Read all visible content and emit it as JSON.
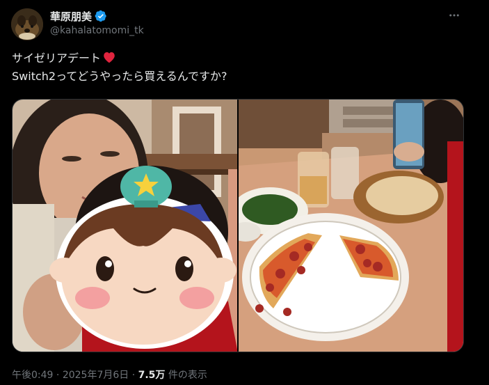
{
  "author": {
    "display_name": "華原朋美",
    "handle": "@kahalatomomi_tk",
    "verified": true,
    "avatar": "avatar-image"
  },
  "more_icon": "more-icon",
  "tweet": {
    "line1": "サイゼリアデート",
    "line1_emoji": "red-heart-emoji",
    "line2": "Switch2ってどうやったら買えるんですか?"
  },
  "media": {
    "images": [
      {
        "name": "selfie-photo",
        "sticker": "cartoon-face-sticker"
      },
      {
        "name": "food-photo"
      }
    ]
  },
  "footer": {
    "time": "午後0:49",
    "separator1": " · ",
    "date": "2025年7月6日",
    "separator2": " · ",
    "views_count": "7.5万",
    "views_label": " 件の表示"
  },
  "colors": {
    "background": "#000000",
    "text": "#e7e9ea",
    "secondary_text": "#71767b",
    "verified_blue": "#1d9bf0",
    "heart_red": "#e0243e"
  }
}
